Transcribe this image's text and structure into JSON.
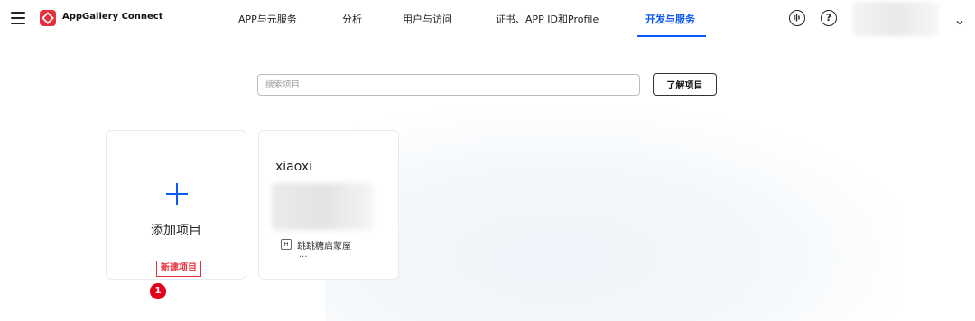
{
  "header": {
    "brand": "AppGallery Connect",
    "nav": [
      {
        "label": "APP与元服务"
      },
      {
        "label": "分析"
      },
      {
        "label": "用户与访问"
      },
      {
        "label": "证书、APP ID和Profile"
      },
      {
        "label": "开发与服务"
      }
    ],
    "active_nav": "开发与服务",
    "help_symbol": "?",
    "icons": [
      "menu-icon",
      "appgallery-logo-icon",
      "voice-feedback-icon",
      "help-icon",
      "chevron-down-icon"
    ]
  },
  "search": {
    "placeholder": "搜索项目",
    "learn_button": "了解项目"
  },
  "cards": {
    "add": {
      "label": "添加项目",
      "tag": "新建项目",
      "badge": "1"
    },
    "project": {
      "name": "xiaoxi",
      "app_icon_letter": "H",
      "app_name": "跳跳糖启蒙屋",
      "more": "..."
    }
  },
  "colors": {
    "accent": "#0a59f7",
    "brand_red": "#e8303c",
    "badge_red": "#e3001b"
  }
}
